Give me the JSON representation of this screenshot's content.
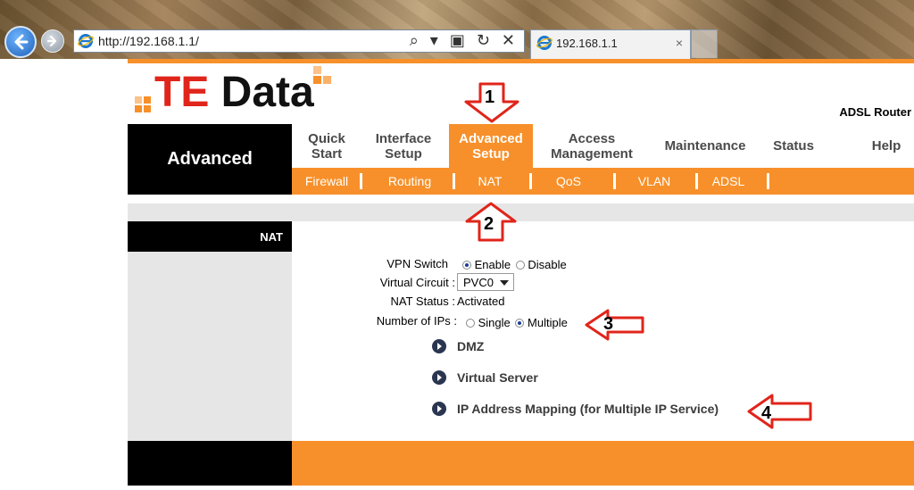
{
  "browser": {
    "url": "http://192.168.1.1/",
    "tab_title": "192.168.1.1",
    "tab_close": "×",
    "address_tools": "⌕ ▾ ▣ ↻ ✕"
  },
  "logo": {
    "te": "TE",
    "data": " Data"
  },
  "device_name": "ADSL Router",
  "section_label": "Advanced",
  "menu": {
    "quick_start": "Quick Start",
    "interface_setup": "Interface Setup",
    "advanced_setup": "Advanced Setup",
    "access_management": "Access Management",
    "maintenance": "Maintenance",
    "status": "Status",
    "help": "Help"
  },
  "submenu": [
    "Firewall",
    "Routing",
    "NAT",
    "QoS",
    "VLAN",
    "ADSL"
  ],
  "side_title": "NAT",
  "form": {
    "vpn_switch_label": "VPN Switch",
    "enable": "Enable",
    "disable": "Disable",
    "virtual_circuit_label": "Virtual Circuit :",
    "virtual_circuit_value": "PVC0",
    "nat_status_label": "NAT Status :",
    "nat_status_value": "Activated",
    "number_of_ips_label": "Number of IPs :",
    "single": "Single",
    "multiple": "Multiple"
  },
  "links": [
    "DMZ",
    "Virtual Server",
    "IP Address Mapping (for Multiple IP Service)"
  ],
  "annotations": [
    "1",
    "2",
    "3",
    "4"
  ],
  "colors": {
    "accent": "#f7902a",
    "annotation": "#e0251b",
    "logo_red": "#e0251b"
  }
}
